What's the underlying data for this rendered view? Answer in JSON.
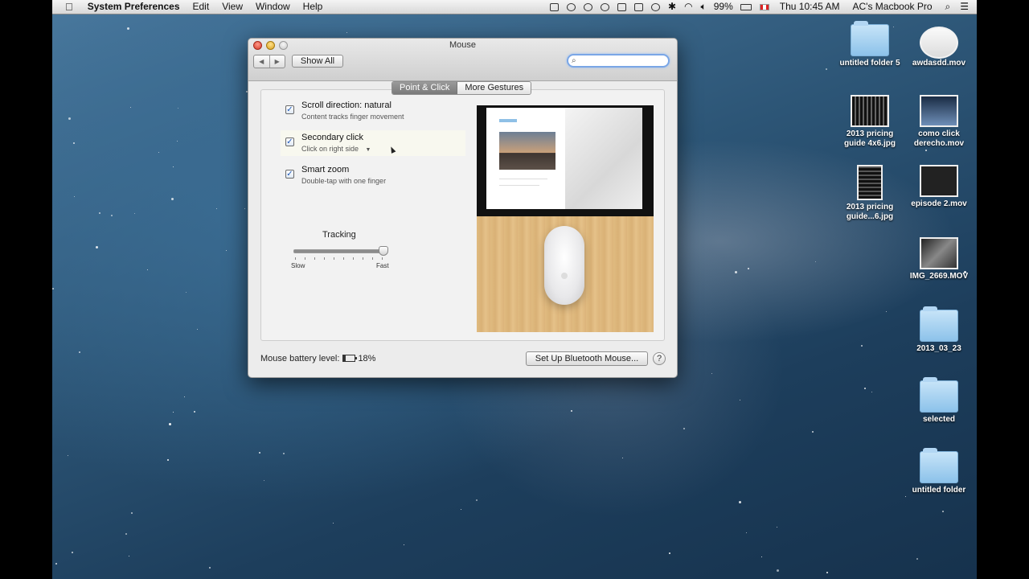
{
  "menubar": {
    "app_name": "System Preferences",
    "menus": [
      "Edit",
      "View",
      "Window",
      "Help"
    ],
    "battery_percent": "99%",
    "clock": "Thu 10:45 AM",
    "user": "AC's Macbook Pro",
    "icons": [
      "apple-icon",
      "shield-icon",
      "sync-icon",
      "cloud-icon",
      "gear-icon",
      "display-icon",
      "airplay-icon",
      "time-machine-icon",
      "bluetooth-icon",
      "wifi-icon",
      "volume-icon",
      "flag-icon",
      "spotlight-icon",
      "menu-list-icon"
    ]
  },
  "window": {
    "title": "Mouse",
    "show_all_label": "Show All",
    "search_placeholder": "",
    "tabs": [
      {
        "label": "Point & Click",
        "selected": true
      },
      {
        "label": "More Gestures",
        "selected": false
      }
    ],
    "options": [
      {
        "title": "Scroll direction: natural",
        "subtitle": "Content tracks finger movement",
        "checked": true
      },
      {
        "title": "Secondary click",
        "subtitle": "Click on right side",
        "checked": true,
        "has_dropdown": true
      },
      {
        "title": "Smart zoom",
        "subtitle": "Double-tap with one finger",
        "checked": true
      }
    ],
    "tracking": {
      "label": "Tracking",
      "min_label": "Slow",
      "max_label": "Fast",
      "value_fraction": 1.0,
      "tick_count": 10
    },
    "battery": {
      "label": "Mouse battery level:",
      "percent_text": "18%",
      "level_fraction": 0.18
    },
    "bluetooth_button_label": "Set Up Bluetooth Mouse...",
    "help_label": "?"
  },
  "desktop_icons": [
    {
      "label": "untitled folder 5",
      "kind": "folder"
    },
    {
      "label": "awdasdd.mov",
      "kind": "thumb-light"
    },
    {
      "label": "2013 pricing guide 4x6.jpg",
      "kind": "thumb-wide"
    },
    {
      "label": "como click derecho.mov",
      "kind": "thumb"
    },
    {
      "label": "2013 pricing guide...6.jpg",
      "kind": "thumb-tall"
    },
    {
      "label": "episode 2.mov",
      "kind": "thumb"
    },
    {
      "label": "IMG_2669.MOV",
      "kind": "thumb"
    },
    {
      "label": "2013_03_23",
      "kind": "folder"
    },
    {
      "label": "selected",
      "kind": "folder"
    },
    {
      "label": "untitled folder",
      "kind": "folder"
    }
  ],
  "colors": {
    "accent_blue": "#3a88c9",
    "search_focus": "#7aa6e6",
    "tab_selected": "#8a8a8a"
  }
}
